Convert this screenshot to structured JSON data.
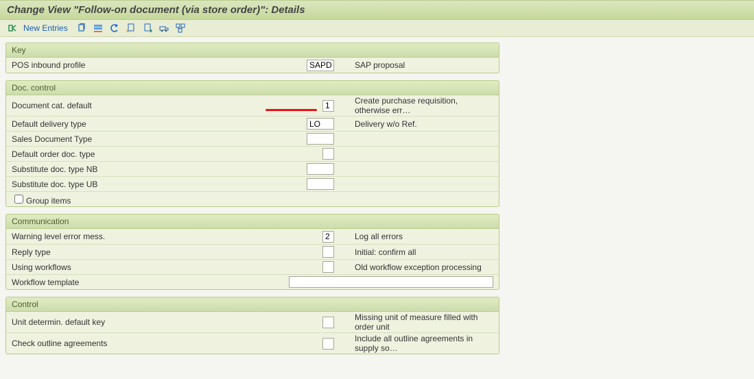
{
  "title": "Change View \"Follow-on document (via store order)\": Details",
  "toolbar": {
    "new_entries": "New Entries"
  },
  "groups": {
    "key": {
      "title": "Key",
      "pos_label": "POS inbound profile",
      "pos_value": "SAPD",
      "pos_descr": "SAP proposal"
    },
    "doccontrol": {
      "title": "Doc. control",
      "r1": {
        "label": "Document cat. default",
        "value": "1",
        "descr": "Create purchase requisition, otherwise err…"
      },
      "r2": {
        "label": "Default delivery type",
        "value": "LO",
        "descr": "Delivery w/o Ref."
      },
      "r3": {
        "label": "Sales Document Type",
        "value": ""
      },
      "r4": {
        "label": "Default order doc. type",
        "value": ""
      },
      "r5": {
        "label": "Substitute doc. type NB",
        "value": ""
      },
      "r6": {
        "label": "Substitute doc. type UB",
        "value": ""
      },
      "r7": {
        "label": "Group items"
      }
    },
    "comm": {
      "title": "Communication",
      "r1": {
        "label": "Warning level error mess.",
        "value": "2",
        "descr": "Log all errors"
      },
      "r2": {
        "label": "Reply type",
        "value": "",
        "descr": "Initial: confirm all"
      },
      "r3": {
        "label": "Using workflows",
        "value": "",
        "descr": "Old workflow exception processing"
      },
      "r4": {
        "label": "Workflow template",
        "value": ""
      }
    },
    "control": {
      "title": "Control",
      "r1": {
        "label": "Unit determin. default key",
        "value": "",
        "descr": "Missing unit of measure filled with order unit"
      },
      "r2": {
        "label": "Check outline agreements",
        "value": "",
        "descr": "Include all outline agreements in supply so…"
      }
    }
  }
}
